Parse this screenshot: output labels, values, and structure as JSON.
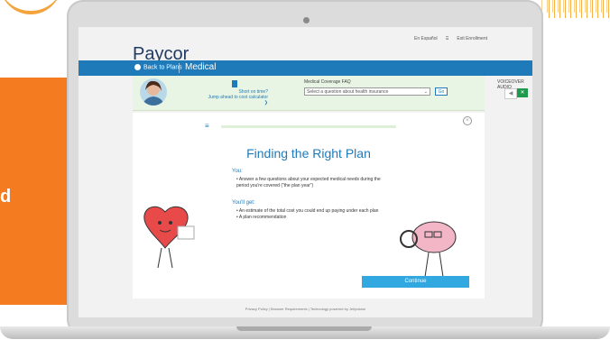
{
  "app": {
    "logo_text": "Paycor",
    "top_links": {
      "spanish": "En Español",
      "exit": "Exit Enrollment"
    }
  },
  "nav": {
    "back_label": "Back to Plans",
    "section_title": "Medical"
  },
  "helpbar": {
    "short_on_time": "Short on time?",
    "jump_label": "Jump ahead to cost calculator",
    "faq_label": "Medical Coverage FAQ",
    "select_placeholder": "Select a question about health insurance",
    "go_label": "Go",
    "voiceover_label": "VOICEOVER AUDIO"
  },
  "card": {
    "title": "Finding the Right Plan",
    "you_heading": "You:",
    "you_items": [
      "Answer a few questions about your expected medical needs during the period you're covered (\"the plan year\")"
    ],
    "get_heading": "You'll get:",
    "get_items": [
      "An estimate of the total cost you could end up paying under each plan",
      "A plan recommendation"
    ],
    "continue_label": "Continue"
  },
  "footer": {
    "text": "Privacy Policy | Browser Requirements | Technology powered by Jellyvision"
  },
  "side": {
    "letter": "d"
  },
  "colors": {
    "brand_blue": "#1f7ab9",
    "orange": "#f47b20",
    "continue_blue": "#31a8e0",
    "voice_green": "#1d9a4c"
  }
}
